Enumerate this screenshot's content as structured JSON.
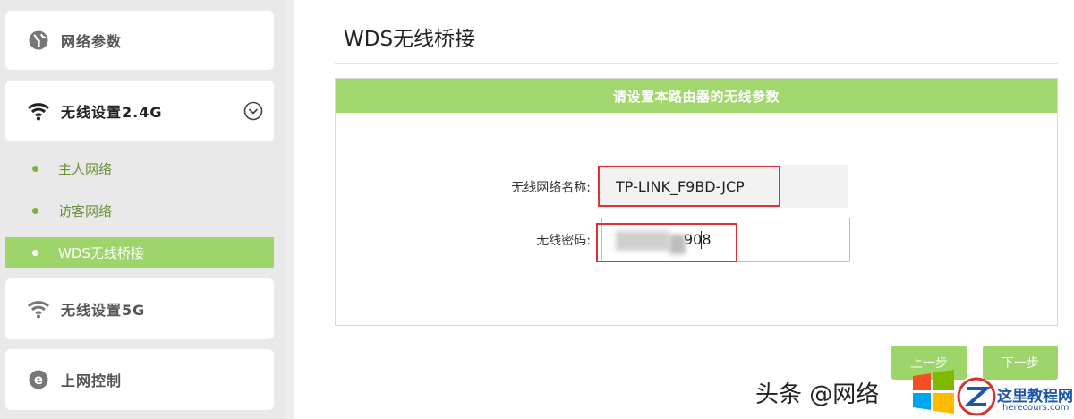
{
  "sidebar": {
    "items": [
      {
        "label": "网络参数",
        "icon": "globe-icon"
      },
      {
        "label": "无线设置2.4G",
        "icon": "wifi-icon",
        "expanded": true
      },
      {
        "label": "无线设置5G",
        "icon": "wifi-icon"
      },
      {
        "label": "上网控制",
        "icon": "e-icon"
      }
    ],
    "subitems": [
      {
        "label": "主人网络",
        "active": false
      },
      {
        "label": "访客网络",
        "active": false
      },
      {
        "label": "WDS无线桥接",
        "active": true
      }
    ]
  },
  "main": {
    "title": "WDS无线桥接",
    "panel_title": "请设置本路由器的无线参数",
    "ssid_label": "无线网络名称:",
    "ssid_value": "TP-LINK_F9BD-JCP",
    "password_label": "无线密码:",
    "password_value_visible_suffix": "908",
    "prev_button": "上一步",
    "next_button": "下一步"
  },
  "watermark": {
    "text": "头条 @网络",
    "site_name": "这里教程网",
    "site_url": "herecours.com"
  },
  "colors": {
    "accent_green": "#a1d76c",
    "highlight_red": "#e0303a",
    "label_green": "#6a8f3a"
  }
}
